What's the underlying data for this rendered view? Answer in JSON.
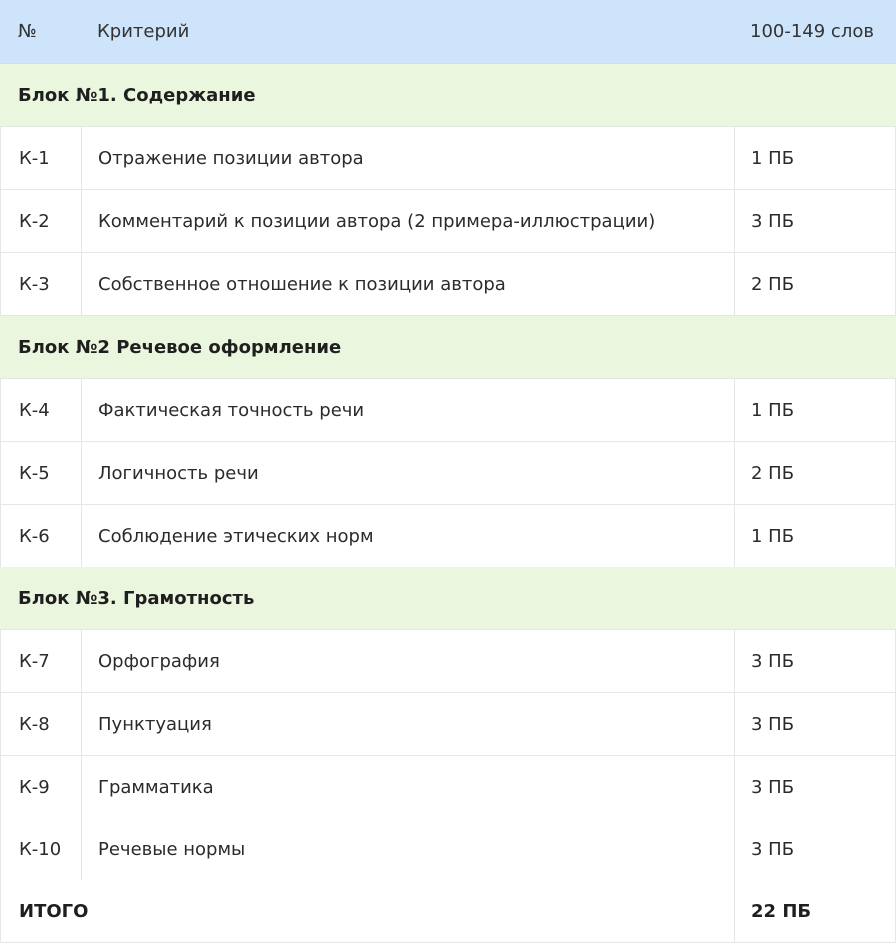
{
  "header": {
    "num": "№",
    "criterion": "Критерий",
    "points": "100-149 слов"
  },
  "blocks": [
    {
      "title": "Блок №1. Содержание",
      "rows": [
        {
          "num": "К-1",
          "criterion": "Отражение позиции автора",
          "points": "1 ПБ"
        },
        {
          "num": "К-2",
          "criterion": "Комментарий к позиции автора (2 примера-иллюстрации)",
          "points": "3 ПБ"
        },
        {
          "num": "К-3",
          "criterion": "Собственное отношение к позиции автора",
          "points": "2 ПБ"
        }
      ]
    },
    {
      "title": "Блок №2 Речевое оформление",
      "rows": [
        {
          "num": "К-4",
          "criterion": "Фактическая точность речи",
          "points": "1 ПБ"
        },
        {
          "num": "К-5",
          "criterion": "Логичность речи",
          "points": "2 ПБ"
        },
        {
          "num": "К-6",
          "criterion": "Соблюдение этических норм",
          "points": "1 ПБ"
        }
      ]
    },
    {
      "title": "Блок №3. Грамотность",
      "rows": [
        {
          "num": "К-7",
          "criterion": "Орфография",
          "points": "3 ПБ"
        },
        {
          "num": "К-8",
          "criterion": "Пунктуация",
          "points": "3 ПБ"
        },
        {
          "num": "К-9",
          "criterion": "Грамматика",
          "points": "3 ПБ"
        },
        {
          "num": "К-10",
          "criterion": "Речевые нормы",
          "points": "3 ПБ"
        }
      ]
    }
  ],
  "total": {
    "label": "ИТОГО",
    "points": "22 ПБ"
  },
  "colors": {
    "header_bg": "#cde4fb",
    "block_bg": "#eaf6de"
  }
}
